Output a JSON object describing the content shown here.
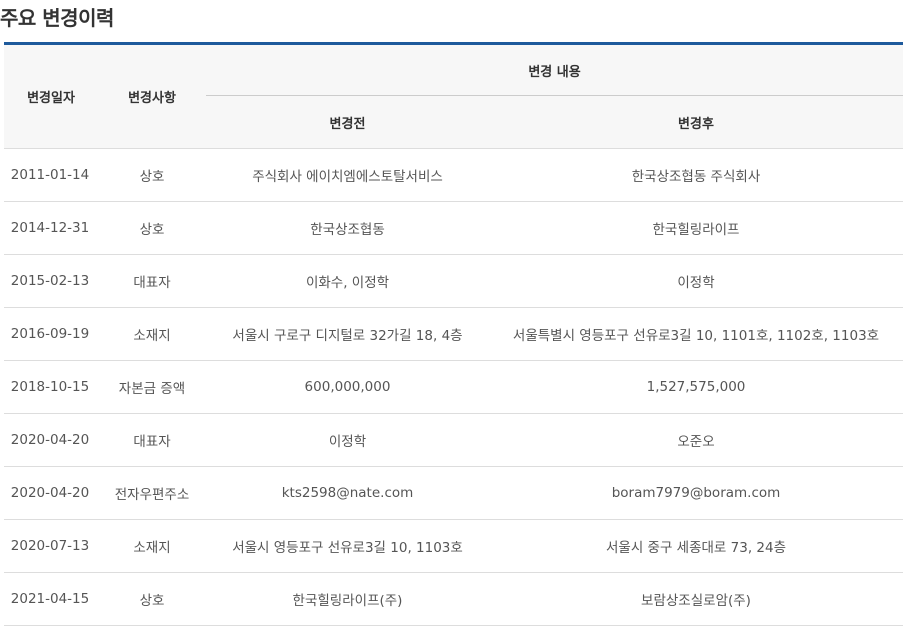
{
  "section": {
    "title": "주요 변경이력"
  },
  "table": {
    "headers": {
      "date": "변경일자",
      "type": "변경사항",
      "content_group": "변경 내용",
      "before": "변경전",
      "after": "변경후"
    },
    "rows": [
      {
        "date": "2011-01-14",
        "type": "상호",
        "before": "주식회사 에이치엠에스토탈서비스",
        "after": "한국상조협동 주식회사"
      },
      {
        "date": "2014-12-31",
        "type": "상호",
        "before": "한국상조협동",
        "after": "한국힐링라이프"
      },
      {
        "date": "2015-02-13",
        "type": "대표자",
        "before": "이화수, 이정학",
        "after": "이정학"
      },
      {
        "date": "2016-09-19",
        "type": "소재지",
        "before": "서울시 구로구 디지털로 32가길 18, 4층",
        "after": "서울특별시 영등포구 선유로3길 10, 1101호, 1102호, 1103호"
      },
      {
        "date": "2018-10-15",
        "type": "자본금 증액",
        "before": "600,000,000",
        "after": "1,527,575,000"
      },
      {
        "date": "2020-04-20",
        "type": "대표자",
        "before": "이정학",
        "after": "오준오"
      },
      {
        "date": "2020-04-20",
        "type": "전자우편주소",
        "before": "kts2598@nate.com",
        "after": "boram7979@boram.com"
      },
      {
        "date": "2020-07-13",
        "type": "소재지",
        "before": "서울시 영등포구 선유로3길 10, 1103호",
        "after": "서울시 중구 세종대로 73, 24층"
      },
      {
        "date": "2021-04-15",
        "type": "상호",
        "before": "한국힐링라이프(주)",
        "after": "보람상조실로암(주)"
      }
    ]
  }
}
